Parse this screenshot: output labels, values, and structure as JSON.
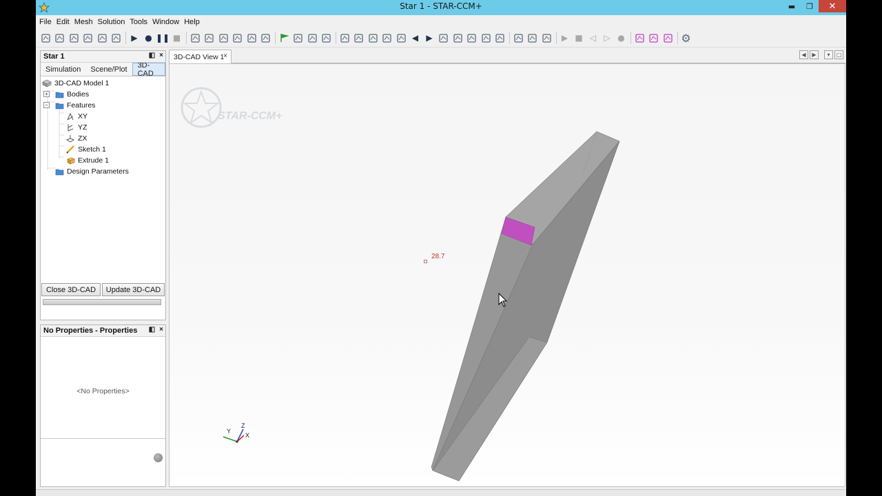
{
  "window": {
    "title": "Star 1 - STAR-CCM+",
    "controls": {
      "minimize": "▬",
      "maximize": "❐",
      "close": "✕"
    }
  },
  "menu": [
    "File",
    "Edit",
    "Mesh",
    "Solution",
    "Tools",
    "Window",
    "Help"
  ],
  "toolbar": {
    "icons": [
      "new-file-icon",
      "open-icon",
      "save-icon",
      "save-as-icon",
      "copy-icon",
      "paste-icon",
      "sep",
      "run-icon",
      "record-icon",
      "pause-icon",
      "stop-icon",
      "sep",
      "mesh-icon",
      "mesh-surface-icon",
      "mesh-volume-icon",
      "repair-icon",
      "wrap-icon",
      "grid-icon",
      "sep",
      "flag-icon",
      "walk-icon",
      "run-fast-icon",
      "cube-icon",
      "sep",
      "screenshot-icon",
      "fit-icon",
      "zoom-icon",
      "select-icon",
      "camera-icon",
      "back-arrow-icon",
      "forward-arrow-icon",
      "rotate-icon",
      "cursor-icon",
      "ruler-icon",
      "table-icon",
      "grid2-icon",
      "sep",
      "plot-icon",
      "plot2-icon",
      "plot3-icon",
      "sep",
      "play-icon",
      "stop2-icon",
      "step-back-icon",
      "step-fwd-icon",
      "record2-icon",
      "sep",
      "cad-pink-icon",
      "cad-pink2-icon",
      "cad-shape-icon",
      "sep",
      "gear-icon"
    ],
    "accent_green": "#2a9a2a",
    "accent_pink": "#c040c0"
  },
  "sim_panel": {
    "title": "Star 1",
    "tabs": [
      "Simulation",
      "Scene/Plot",
      "3D-CAD"
    ],
    "active_tab": "3D-CAD",
    "tree": [
      {
        "label": "3D-CAD Model 1",
        "icon": "cad-model-icon",
        "level": 0
      },
      {
        "label": "Bodies",
        "icon": "folder-icon",
        "level": 1,
        "expander": "+"
      },
      {
        "label": "Features",
        "icon": "folder-icon",
        "level": 1,
        "expander": "−"
      },
      {
        "label": "XY",
        "icon": "plane-xy-icon",
        "level": 2
      },
      {
        "label": "YZ",
        "icon": "plane-yz-icon",
        "level": 2
      },
      {
        "label": "ZX",
        "icon": "plane-zx-icon",
        "level": 2
      },
      {
        "label": "Sketch 1",
        "icon": "sketch-icon",
        "level": 2
      },
      {
        "label": "Extrude 1",
        "icon": "extrude-icon",
        "level": 2
      },
      {
        "label": "Design Parameters",
        "icon": "folder-icon",
        "level": 1
      }
    ],
    "buttons": {
      "close": "Close 3D-CAD",
      "update": "Update 3D-CAD"
    }
  },
  "props_panel": {
    "title": "No Properties - Properties",
    "empty_text": "<No Properties>"
  },
  "view": {
    "tab_label": "3D-CAD View 1",
    "logo_text": "STAR-CCM+",
    "dimension_label": "28.7",
    "axes": {
      "x": "X",
      "y": "Y",
      "z": "Z"
    },
    "body_color": "#8e8e8e",
    "highlight_color": "#c050c0"
  }
}
